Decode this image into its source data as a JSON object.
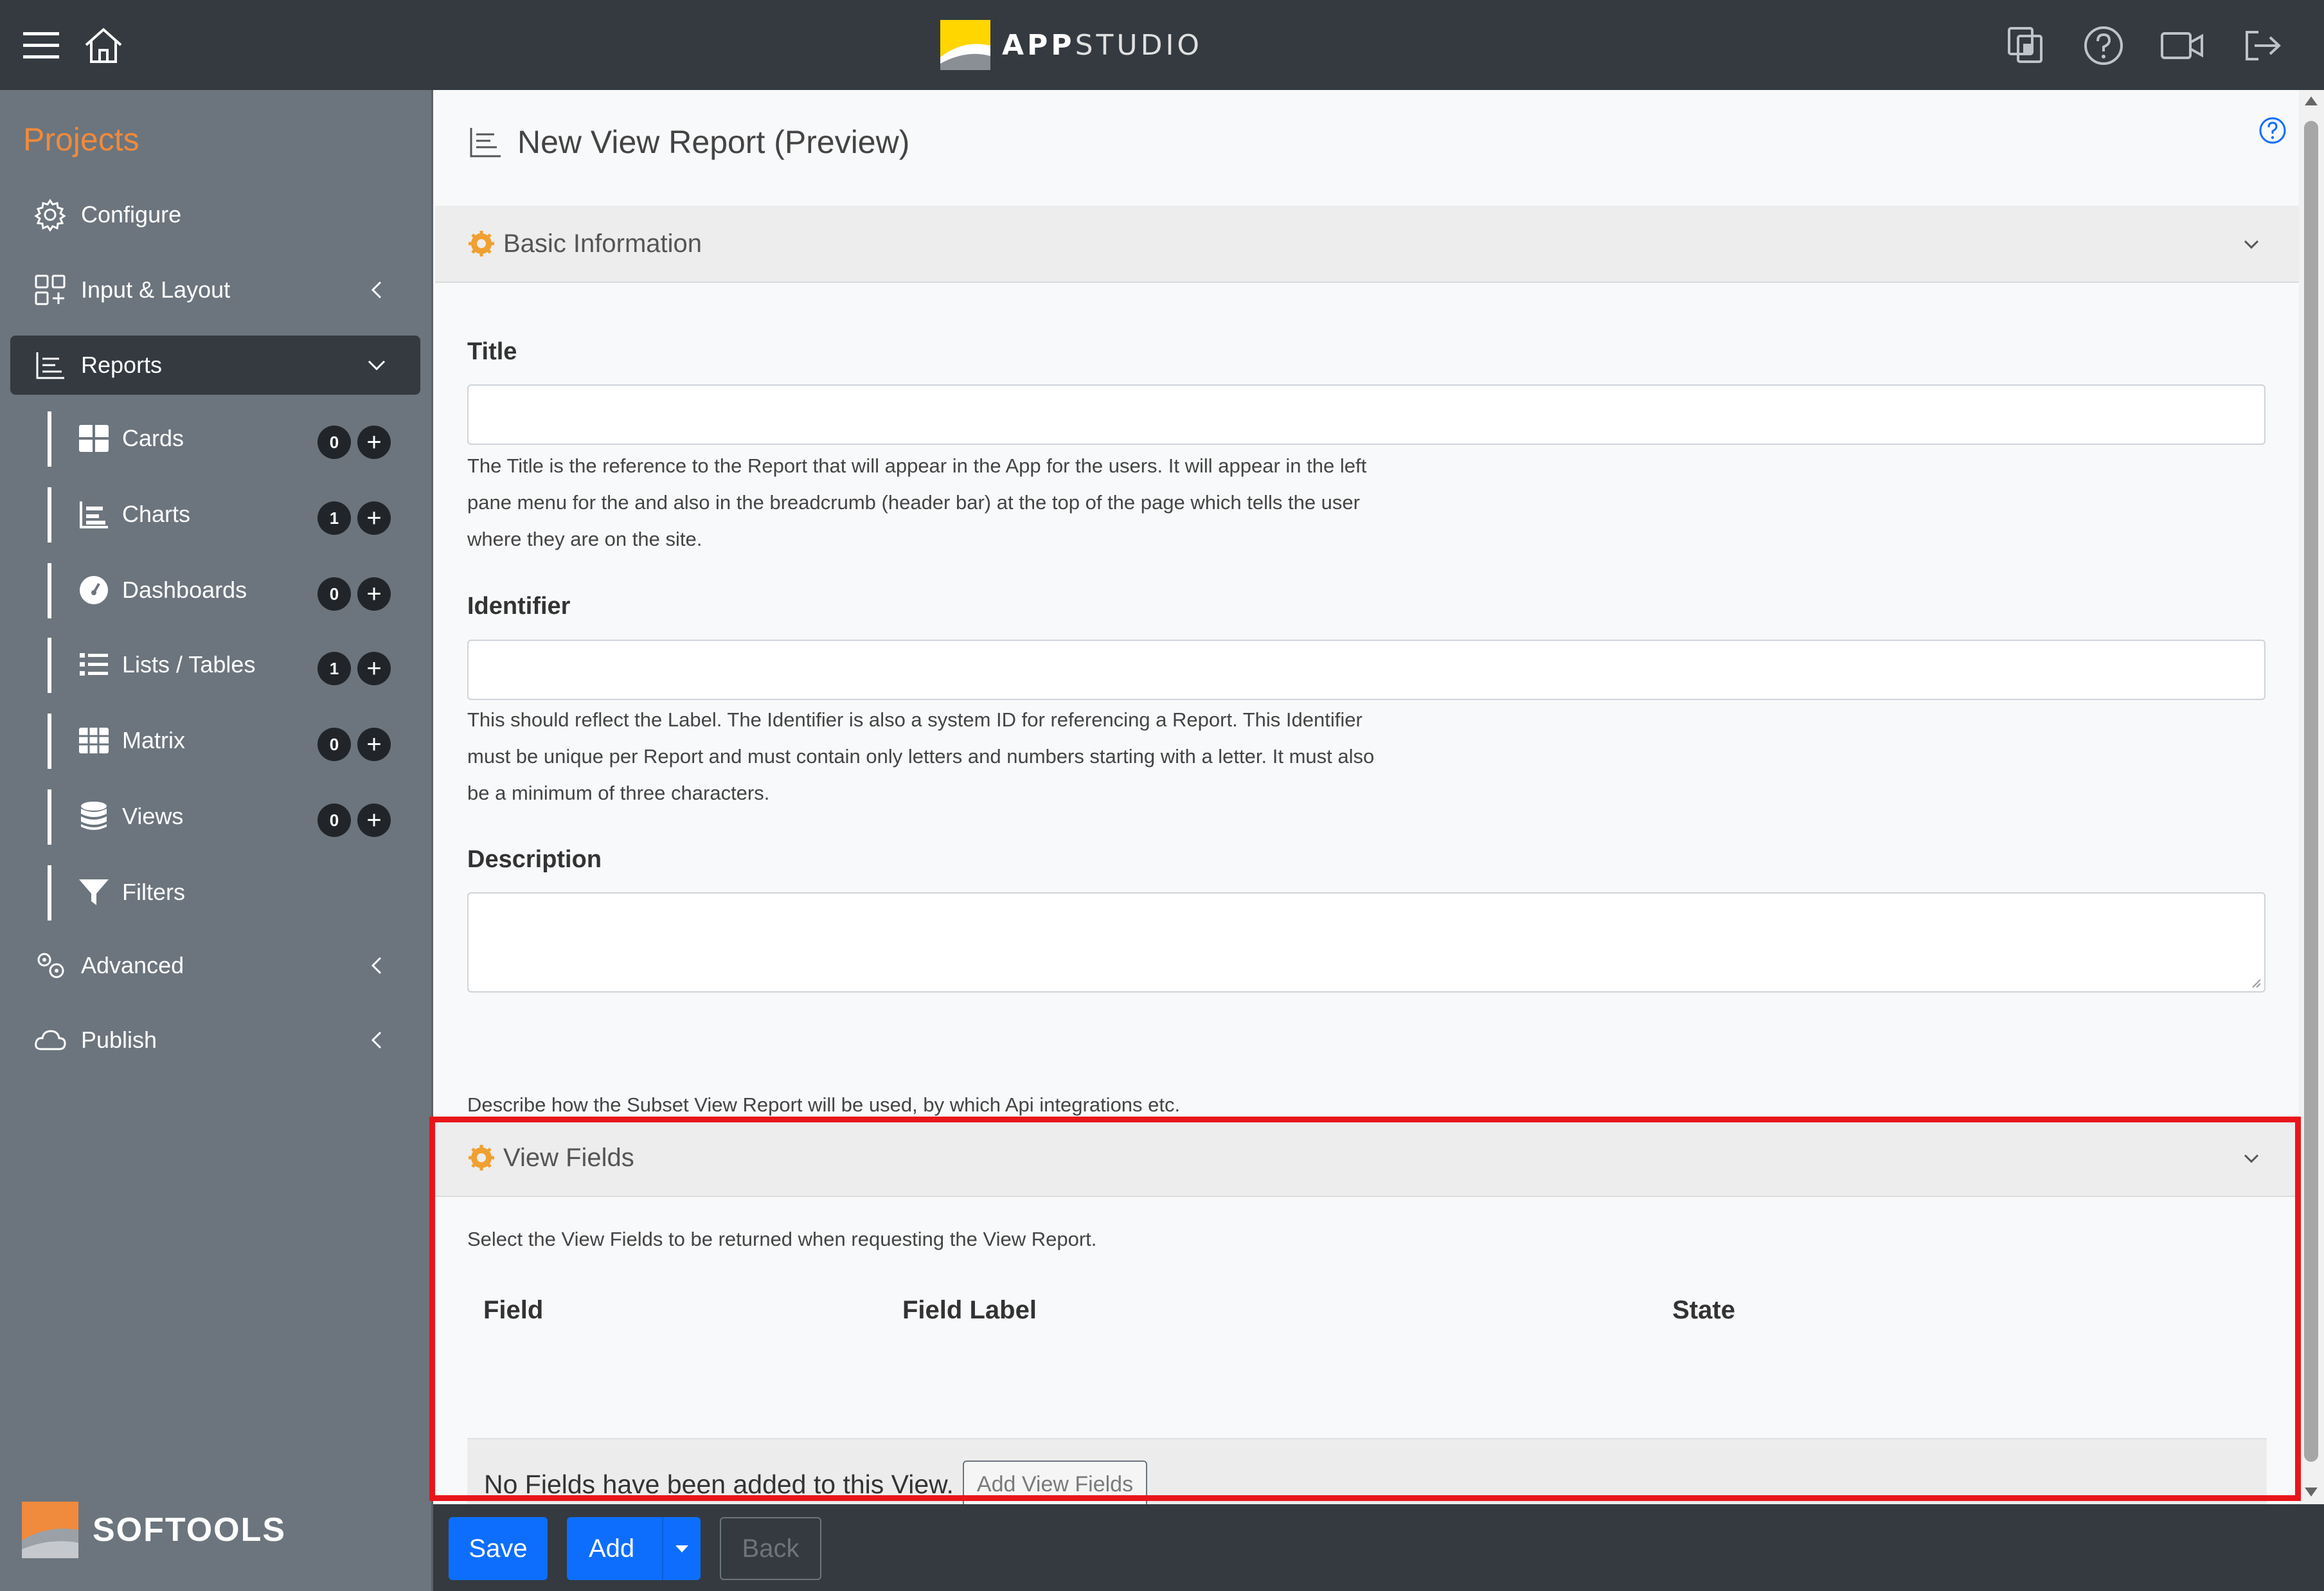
{
  "app": {
    "brand_bold": "APP",
    "brand_light": "STUDIO",
    "accent_color": "#f08a3c",
    "highlight_color": "#e8161b"
  },
  "topbar": {
    "icons": [
      "menu-icon",
      "home-icon",
      "copy-icon",
      "help-icon",
      "video-icon",
      "logout-icon"
    ]
  },
  "sidebar": {
    "projects_label": "Projects",
    "items": [
      {
        "label": "Configure",
        "icon": "gear-icon"
      },
      {
        "label": "Input & Layout",
        "icon": "layout-icon"
      },
      {
        "label": "Reports",
        "icon": "chart-icon"
      },
      {
        "label": "Advanced",
        "icon": "gears-icon"
      },
      {
        "label": "Publish",
        "icon": "cloud-icon"
      }
    ],
    "sub_items": [
      {
        "label": "Cards",
        "count": "0",
        "add": "+"
      },
      {
        "label": "Charts",
        "count": "1",
        "add": "+"
      },
      {
        "label": "Dashboards",
        "count": "0",
        "add": "+"
      },
      {
        "label": "Lists / Tables",
        "count": "1",
        "add": "+"
      },
      {
        "label": "Matrix",
        "count": "0",
        "add": "+"
      },
      {
        "label": "Views",
        "count": "0",
        "add": "+"
      },
      {
        "label": "Filters"
      }
    ],
    "footer_brand": "SOFTOOLS"
  },
  "main": {
    "page_title": "New View Report (Preview)",
    "basic_info": {
      "heading": "Basic Information",
      "title_label": "Title",
      "title_value": "",
      "title_help": "The Title is the reference to the Report that will appear in the App for the users. It will appear in the left pane menu for the and also in the breadcrumb (header bar) at the top of the page which tells the user where they are on the site.",
      "identifier_label": "Identifier",
      "identifier_value": "",
      "identifier_help": "This should reflect the Label. The Identifier is also a system ID for referencing a Report. This Identifier must be unique per Report and must contain only letters and numbers starting with a letter. It must also be a minimum of three characters.",
      "description_label": "Description",
      "description_value": "",
      "description_help": "Describe how the Subset View Report will be used, by which Api integrations etc."
    },
    "view_fields": {
      "heading": "View Fields",
      "intro": "Select the View Fields to be returned when requesting the View Report.",
      "columns": [
        "Field",
        "Field Label",
        "State"
      ],
      "empty_text": "No Fields have been added to this View.",
      "add_button": "Add View Fields"
    }
  },
  "bottombar": {
    "save_label": "Save",
    "add_label": "Add",
    "back_label": "Back"
  }
}
